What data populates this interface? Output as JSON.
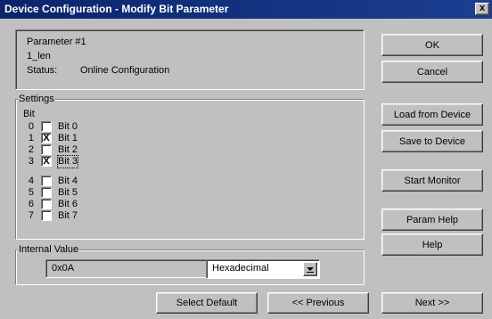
{
  "window": {
    "title": "Device Configuration - Modify Bit Parameter",
    "close_glyph": "x"
  },
  "info": {
    "parameter": "Parameter #1",
    "name": "1_len",
    "status_label": "Status:",
    "status_value": "Online Configuration"
  },
  "settings": {
    "group_label": "Settings",
    "bit_header": "Bit",
    "bits": [
      {
        "num": "0",
        "label": "Bit 0",
        "checked": false
      },
      {
        "num": "1",
        "label": "Bit 1",
        "checked": true
      },
      {
        "num": "2",
        "label": "Bit 2",
        "checked": false
      },
      {
        "num": "3",
        "label": "Bit 3",
        "checked": true,
        "focused": true
      },
      {
        "num": "4",
        "label": "Bit 4",
        "checked": false
      },
      {
        "num": "5",
        "label": "Bit 5",
        "checked": false
      },
      {
        "num": "6",
        "label": "Bit 6",
        "checked": false
      },
      {
        "num": "7",
        "label": "Bit 7",
        "checked": false
      }
    ]
  },
  "internal_value": {
    "group_label": "Internal Value",
    "value": "0x0A",
    "format_selected": "Hexadecimal"
  },
  "buttons": {
    "ok": "OK",
    "cancel": "Cancel",
    "load_from_device": "Load from Device",
    "save_to_device": "Save to Device",
    "start_monitor": "Start Monitor",
    "param_help": "Param Help",
    "help": "Help",
    "select_default": "Select Default",
    "previous": "<< Previous",
    "next": "Next >>"
  },
  "check_glyph": "X"
}
